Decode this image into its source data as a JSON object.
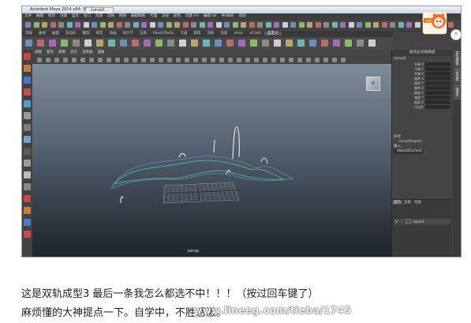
{
  "window": {
    "title": "Autodesk Maya 2014 x64: 无标题*",
    "tab": "curve2..."
  },
  "menus": [
    "文件",
    "编辑",
    "修改",
    "创建",
    "显示",
    "窗口",
    "资源",
    "选择",
    "网格",
    "编辑网格",
    "代理",
    "法线",
    "颜色",
    "创建 UV",
    "编辑 UV",
    "MUBBS",
    "帮助"
  ],
  "shelf_tabs": [
    {
      "label": "常规",
      "active": false
    },
    {
      "label": "曲线",
      "active": false
    },
    {
      "label": "曲面",
      "active": false
    },
    {
      "label": "多边形",
      "active": false
    },
    {
      "label": "雕刻",
      "active": false
    },
    {
      "label": "绑定",
      "active": false
    },
    {
      "label": "动画",
      "active": false
    },
    {
      "label": "动力学",
      "active": false
    },
    {
      "label": "渲染",
      "active": false
    },
    {
      "label": "PaintEffects",
      "active": false
    },
    {
      "label": "卡通",
      "active": false
    },
    {
      "label": "肌肉",
      "active": false
    },
    {
      "label": "流体",
      "active": false
    },
    {
      "label": "毛发",
      "active": false
    },
    {
      "label": "nHair",
      "active": false
    },
    {
      "label": "nCloth",
      "active": false
    },
    {
      "label": "自定义",
      "active": true
    }
  ],
  "viewport": {
    "menu": [
      "视图",
      "着色",
      "照明",
      "显示",
      "渲染器",
      "面板"
    ],
    "cube_label": "前",
    "status": "persp"
  },
  "channel_box": {
    "header": "通道盒/层编辑器",
    "object": "curve2",
    "attributes": [
      "平移 X",
      "平移 Y",
      "平移 Z",
      "旋转 X",
      "旋转 Y",
      "旋转 Z",
      "缩放 X",
      "缩放 Y",
      "缩放 Z",
      "可见性"
    ],
    "shapes_label": "形状",
    "shape": "curveShape2",
    "inputs_label": "输入",
    "input": "rebuildCurve1",
    "side_tabs": [
      "属性编辑器",
      "工具设置",
      "通道盒"
    ]
  },
  "layer_editor": {
    "tabs": [
      {
        "label": "显示",
        "active": true
      },
      {
        "label": "渲染",
        "active": false
      },
      {
        "label": "动画",
        "active": false
      }
    ],
    "layer": {
      "v": "V",
      "name": "layer1"
    }
  },
  "caption": {
    "line1": "这是双轨成型3 最后一条我怎么都选不中！！！（按过回车键了）",
    "line2": "麻烦懂的大神提点一下。自学中，不胜感激。"
  },
  "watermark": "www.lineeg.com/tieba/1745",
  "mascot": {
    "label": "小吧"
  },
  "colors": {
    "accent": "#ff6a00",
    "curve_green": "#4fae8f",
    "curve_blue": "#5a7fb0"
  }
}
